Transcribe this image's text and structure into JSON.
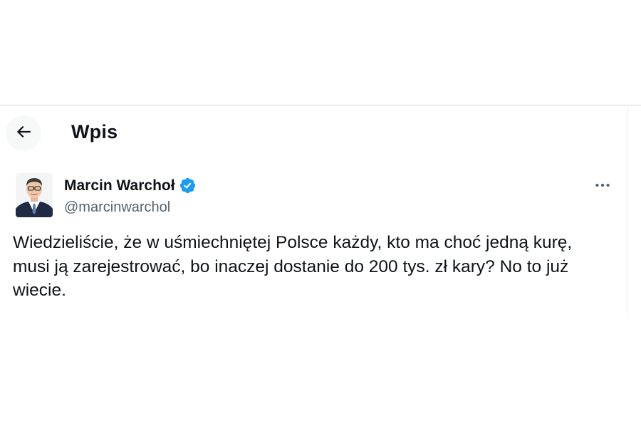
{
  "header": {
    "title": "Wpis"
  },
  "post": {
    "author": {
      "name": "Marcin Warchoł",
      "handle": "@marcinwarchol",
      "verified": true
    },
    "text": "Wiedzieliście, że w uśmiechniętej Polsce każdy, kto ma choć jedną kurę,\nmusi ją zarejestrować, bo inaczej dostanie do 200 tys. zł kary? No to już\nwiecie."
  },
  "icons": {
    "back": "arrow-left-icon",
    "verified": "verified-badge-icon",
    "more": "more-horizontal-icon"
  },
  "colors": {
    "text_primary": "#0f1419",
    "text_secondary": "#536471",
    "verified_blue": "#1d9bf0",
    "divider": "#d4d4d4"
  }
}
